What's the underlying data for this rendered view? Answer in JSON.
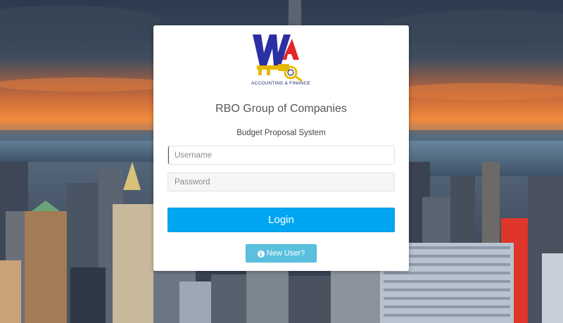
{
  "brand": {
    "logo_mark": "WA",
    "logo_tagline": "ACCOUNTING & FINANCE",
    "colors": {
      "logo_blue": "#2a2fa3",
      "logo_red": "#e3262b",
      "logo_gold": "#e6b800"
    }
  },
  "header": {
    "company": "RBO Group of Companies",
    "system": "Budget Proposal System"
  },
  "form": {
    "username_placeholder": "Username",
    "username_value": "",
    "password_placeholder": "Password",
    "password_value": "",
    "login_label": "Login",
    "new_user_label": "New User?",
    "new_user_icon": "info-circle-icon"
  },
  "theme": {
    "primary": "#00a6f2",
    "info": "#5bc0de",
    "card_bg": "#ffffff"
  }
}
